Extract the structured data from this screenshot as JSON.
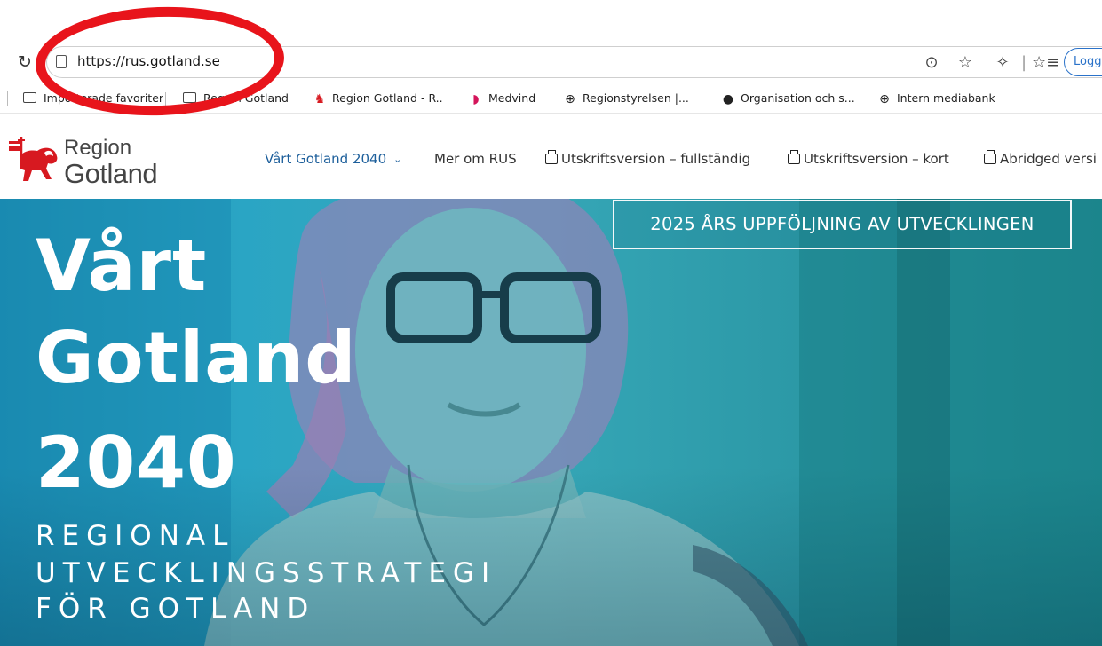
{
  "browser": {
    "url_scheme": "https://",
    "url_host": "rus.gotland.se",
    "login_label": "Logg",
    "icons": {
      "reload": "reload-icon",
      "more": "more-options-icon",
      "favorite": "star-icon",
      "extensions": "puzzle-icon",
      "favorites_list": "favorites-list-icon"
    }
  },
  "favorites": [
    {
      "label": "Importerade favoriter",
      "icon": "folder-icon"
    },
    {
      "label": "Region Gotland",
      "icon": "folder-icon"
    },
    {
      "label": "Region Gotland - R..",
      "icon": "region-gotland-icon"
    },
    {
      "label": "Medvind",
      "icon": "medvind-icon"
    },
    {
      "label": "Regionstyrelsen |...",
      "icon": "globe-icon"
    },
    {
      "label": "Organisation och s...",
      "icon": "org-icon"
    },
    {
      "label": "Intern mediabank",
      "icon": "globe-icon"
    }
  ],
  "site": {
    "logo_line1": "Region",
    "logo_line2": "Gotland",
    "nav": [
      {
        "label": "Vårt Gotland 2040"
      },
      {
        "label": "Mer om RUS"
      },
      {
        "label": "Utskriftsversion – fullständig"
      },
      {
        "label": "Utskriftsversion – kort"
      },
      {
        "label": "Abridged versi"
      }
    ],
    "brand_color": "#1d5f9b",
    "logo_red": "#d71920"
  },
  "hero": {
    "title_lines": [
      "Vårt",
      "Gotland",
      "2040"
    ],
    "subtitle_lines": [
      "REGIONAL",
      "UTVECKLINGSSTRATEGI",
      "FÖR GOTLAND"
    ],
    "cta_label": "2025 ÅRS UPPFÖLJNING AV UTVECKLINGEN",
    "teal_color": "#2aa5c4"
  },
  "annotation": {
    "color": "#e8141b"
  }
}
